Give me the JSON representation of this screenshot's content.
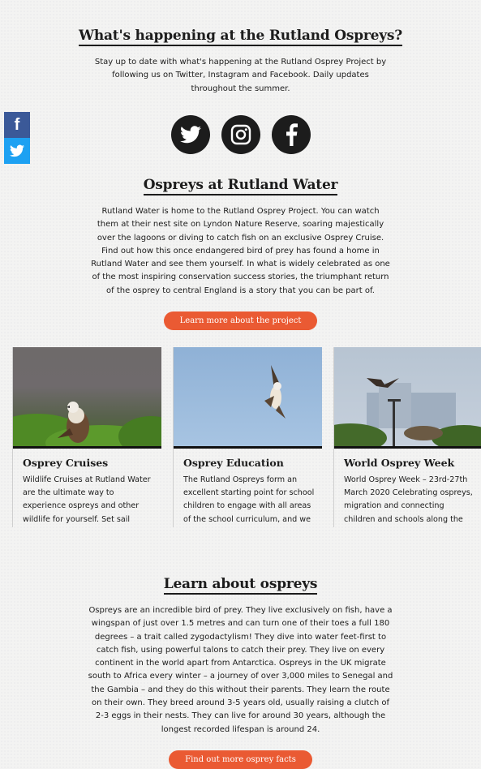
{
  "happening": {
    "title": "What's happening at the Rutland Ospreys?",
    "text": "Stay up to date with what's happening at the Rutland Osprey Project by following us on Twitter, Instagram and Facebook. Daily updates throughout the summer."
  },
  "social": {
    "icons": [
      "twitter-icon",
      "instagram-icon",
      "facebook-icon"
    ],
    "side_facebook": "f",
    "side_twitter": "twitter"
  },
  "rutland": {
    "title": "Ospreys at Rutland Water",
    "text": "Rutland Water is home to the Rutland Osprey Project. You can watch them at their nest site on Lyndon Nature Reserve, soaring majestically over the lagoons or diving to catch fish on an exclusive Osprey Cruise. Find out how this once endangered bird of prey has found a home in Rutland Water and see them yourself. In what is widely celebrated as one of the most inspiring conservation success stories, the triumphant return of the osprey to central England is a story that you can be part of.",
    "button": "Learn more about the project"
  },
  "cards": [
    {
      "title": "Osprey Cruises",
      "text": "Wildlife Cruises at Rutland Water are the ultimate way to experience ospreys and other wildlife for yourself. Set sail aboard the..."
    },
    {
      "title": "Osprey Education",
      "text": "The Rutland Ospreys form an excellent starting point for school children to engage with all areas of the school curriculum, and we link..."
    },
    {
      "title": "World Osprey Week",
      "text": "World Osprey Week – 23rd-27th March 2020 Celebrating ospreys, migration and connecting children and schools along the flyway"
    }
  ],
  "learn": {
    "title": "Learn about ospreys",
    "text": "Ospreys are an incredible bird of prey. They live exclusively on fish, have a wingspan of just over 1.5 metres and can turn one of their toes a full 180 degrees – a trait called zygodactylism! They dive into water feet-first to catch fish, using powerful talons to catch their prey. They live on every continent in the world apart from Antarctica. Ospreys in the UK migrate south to Africa every winter – a journey of over 3,000 miles to Senegal and the Gambia – and they do this without their parents. They learn the route on their own. They breed around 3-5 years old, usually raising a clutch of 2-3 eggs in their nests. They can live for around 30 years, although the longest recorded lifespan is around 24.",
    "button": "Find out more osprey facts"
  },
  "colors": {
    "accent": "#ea5a33",
    "facebook": "#3b5998",
    "twitter": "#1da1f2",
    "dark": "#1c1c1c"
  }
}
